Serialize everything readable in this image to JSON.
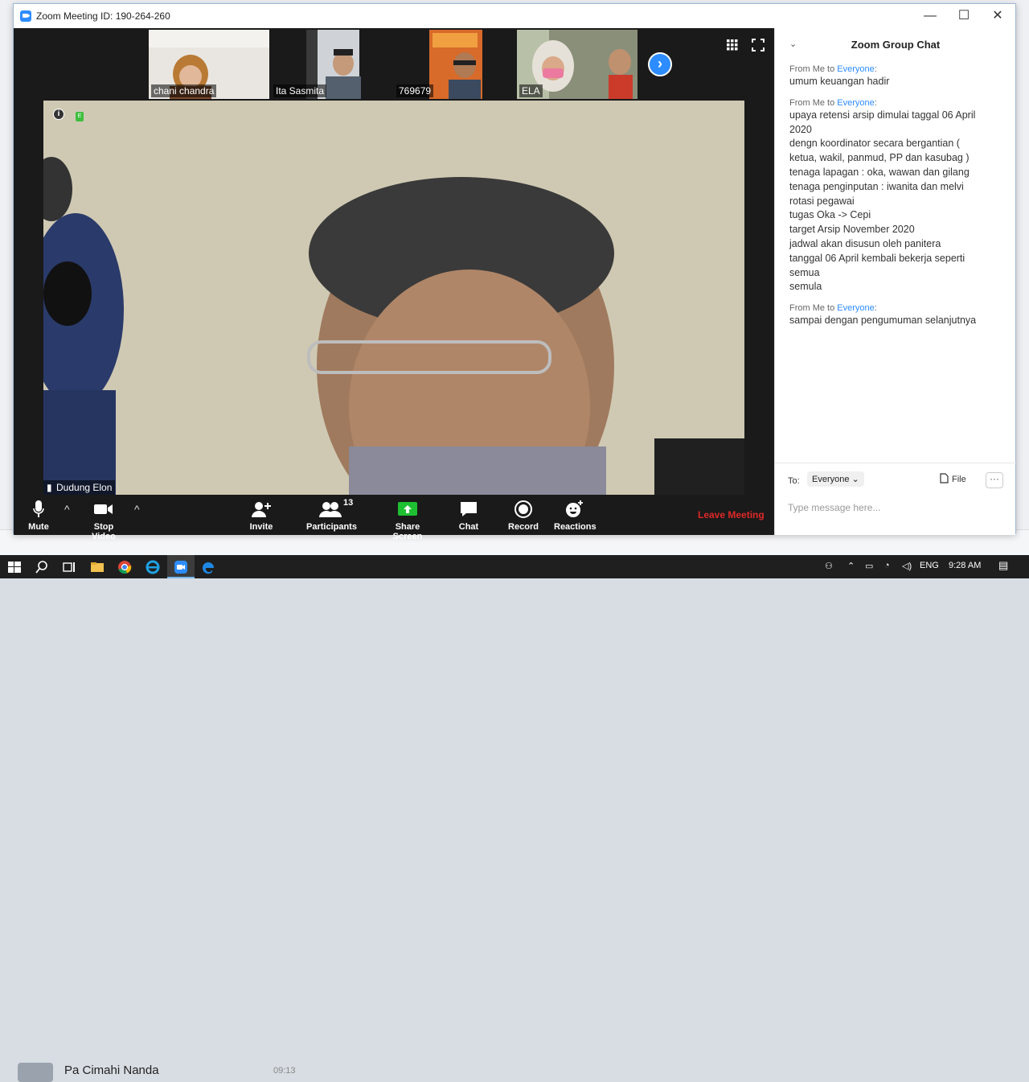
{
  "window": {
    "title": "Zoom Meeting ID: 190-264-260"
  },
  "titlebar": {
    "minimize": "—",
    "maximize": "☐",
    "close": "✕"
  },
  "thumbnails": [
    {
      "name": "chani chandra"
    },
    {
      "name": "Ita Sasmita"
    },
    {
      "name": "769679"
    },
    {
      "name": "ELA"
    }
  ],
  "main_video": {
    "speaker": "Dudung Elon",
    "badge": "E",
    "info": "i"
  },
  "toolbar": {
    "mute": "Mute",
    "stop_video": "Stop Video",
    "invite": "Invite",
    "participants": "Participants",
    "participants_count": "13",
    "share_screen": "Share Screen",
    "chat": "Chat",
    "record": "Record",
    "reactions": "Reactions",
    "leave": "Leave Meeting",
    "caret": "^"
  },
  "chat": {
    "title": "Zoom Group Chat",
    "collapse": "⌄",
    "messages": [
      {
        "from": "From Me to ",
        "to": "Everyone",
        "colon": ":",
        "lines": [
          "umum keuangan hadir"
        ]
      },
      {
        "from": "From Me to ",
        "to": "Everyone",
        "colon": ":",
        "lines": [
          "upaya retensi arsip dimulai taggal 06 April",
          "2020",
          "dengn koordinator secara bergantian (",
          "ketua, wakil, panmud, PP dan kasubag )",
          "tenaga lapagan : oka, wawan dan gilang",
          "tenaga penginputan : iwanita dan melvi",
          "rotasi pegawai",
          "tugas Oka -> Cepi",
          "target Arsip November 2020",
          "jadwal akan disusun oleh panitera",
          "tanggal 06 April kembali bekerja seperti",
          "semua",
          "semula"
        ]
      },
      {
        "from": "From Me to ",
        "to": "Everyone",
        "colon": ":",
        "lines": [
          "sampai dengan pengumuman selanjutnya"
        ]
      }
    ],
    "to_label": "To:",
    "to_value": "Everyone ⌄",
    "file": "File",
    "more": "···",
    "placeholder": "Type message here..."
  },
  "background": {
    "contact_name": "Pa Cimahi Nanda",
    "contact_time": "09:13"
  },
  "taskbar": {
    "lang": "ENG",
    "time": "9:28 AM"
  },
  "colors": {
    "accent": "#2d8cff",
    "leave": "#e02828",
    "share": "#1fbf32"
  }
}
